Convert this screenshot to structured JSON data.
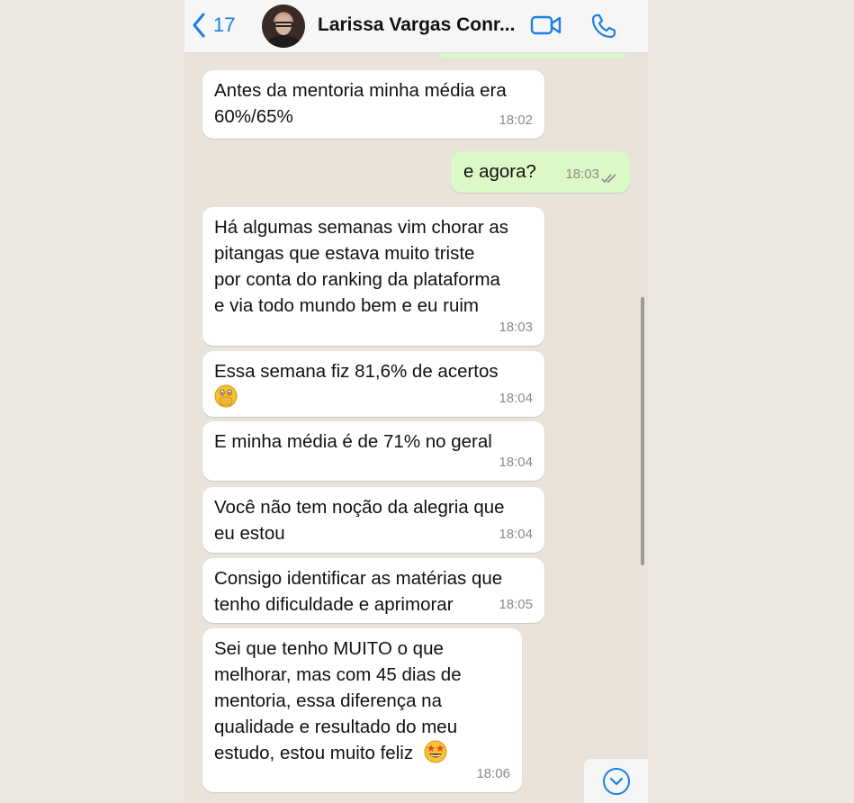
{
  "header": {
    "back_count": "17",
    "contact_name": "Larissa Vargas Conr..."
  },
  "colors": {
    "accent": "#1a7fe0",
    "incoming_bubble": "#ffffff",
    "outgoing_bubble": "#dcf8c6",
    "chat_background": "#e9e3da"
  },
  "icons": {
    "back": "chevron-left-icon",
    "video": "video-camera-icon",
    "call": "phone-icon",
    "read_receipt": "double-check-icon",
    "scroll_down": "chevron-down-circle-icon"
  },
  "messages": [
    {
      "direction": "in",
      "text": "Antes da mentoria minha média era\n60%/65%",
      "time": "18:02"
    },
    {
      "direction": "out",
      "text": "e agora?",
      "time": "18:03"
    },
    {
      "direction": "in",
      "text": "Há algumas semanas vim chorar as\npitangas que estava muito triste\npor conta do ranking da plataforma\ne via todo mundo bem e eu ruim",
      "time": "18:03"
    },
    {
      "direction": "in",
      "text": "Essa semana fiz 81,6% de acertos",
      "emoji": "face-with-hand-over-mouth",
      "time": "18:04"
    },
    {
      "direction": "in",
      "text": "E minha média é de 71% no geral",
      "time": "18:04"
    },
    {
      "direction": "in",
      "text": "Você não tem noção da alegria que\neu estou",
      "time": "18:04"
    },
    {
      "direction": "in",
      "text": "Consigo identificar as matérias que\ntenho dificuldade e aprimorar",
      "time": "18:05"
    },
    {
      "direction": "in",
      "text": "Sei que tenho MUITO o que\nmelhorar, mas com 45 dias de\nmentoria, essa diferença na\nqualidade e resultado do meu\nestudo, estou muito feliz",
      "emoji": "star-struck",
      "time": "18:06"
    }
  ]
}
